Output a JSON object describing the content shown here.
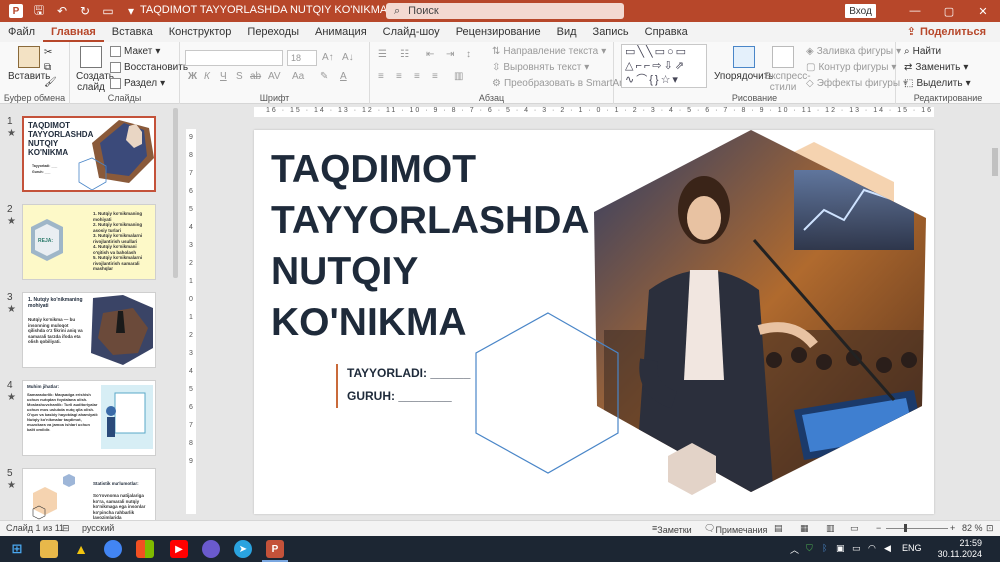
{
  "titlebar": {
    "doc_title": "TAQDIMOT TAYYORLASHDA NUTQIY KO'NIKMA  -  PowerPoint",
    "search_placeholder": "Поиск",
    "login_label": "Вход",
    "minimize": "—",
    "restore": "▢",
    "close": "✕"
  },
  "tabs": [
    "Файл",
    "Главная",
    "Вставка",
    "Конструктор",
    "Переходы",
    "Анимация",
    "Слайд-шоу",
    "Рецензирование",
    "Вид",
    "Запись",
    "Справка"
  ],
  "active_tab": "Главная",
  "share_label": "Поделиться",
  "ribbon": {
    "paste_label": "Вставить",
    "clipboard_group": "Буфер обмена",
    "new_slide_label": "Создать слайд",
    "layout_label": "Макет",
    "reset_label": "Восстановить",
    "section_label": "Раздел",
    "slides_group": "Слайды",
    "font_size": "18",
    "font_group": "Шрифт",
    "text_direction_label": "Направление текста",
    "align_text_label": "Выровнять текст",
    "smartart_label": "Преобразовать в SmartArt",
    "paragraph_group": "Абзац",
    "arrange_label": "Упорядочить",
    "quick_styles_label": "Экспресс-стили",
    "shape_fill_label": "Заливка фигуры",
    "shape_outline_label": "Контур фигуры",
    "shape_effects_label": "Эффекты фигуры",
    "drawing_group": "Рисование",
    "find_label": "Найти",
    "replace_label": "Заменить",
    "select_label": "Выделить",
    "editing_group": "Редактирование"
  },
  "thumbnails": [
    {
      "num": "1",
      "title": "TAQDIMOT TAYYORLASHDA NUTQIY KO'NIKMA",
      "selected": true
    },
    {
      "num": "2",
      "title": "REJA:",
      "lines": [
        "1. Nutqiy ko'nikmaning mohiyati",
        "2. Nutqiy ko'nikmaning asosiy turlari",
        "3. Nutqiy ko'nikmalarni rivojlantirish usullari",
        "4. Nutqiy ko'nikmani o'qitish va baholash",
        "5. Nutqiy ko'nikmalarni rivojlantirish samarali mashqlar"
      ]
    },
    {
      "num": "3",
      "title": "1. Nutqiy ko'nikmaning mohiyati",
      "lines": [
        "Nutqiy ko'nikma — bu insonning muloqot qilishda o'z fikrini aniq va samarali tarzda ifoda eta olish qobiliyati."
      ]
    },
    {
      "num": "4",
      "title": "Muhim jihatlar:",
      "lines": [
        "Samaradorlik: Maqsadga erishish uchun nutqdan foydalana olish.",
        "Moslashuvchanlik: Turli auditoriyalar uchun mos uslubda nutq qila olish.",
        "O'quv va kasbiy hayotdagi ahamiyati: Nutqiy ko'nikmalar taqdimot, muzokara va jamoa ishlari uchun kalit omildir."
      ]
    },
    {
      "num": "5",
      "title": "Statistik ma'lumotlar:",
      "lines": [
        "So'rovnoma natijalariga ko'ra, samarali nutqiy ko'nikmaga ega insonlar ko'pincha rahbarlik lavozimlarida"
      ]
    }
  ],
  "slide": {
    "title": "TAQDIMOT TAYYORLASHDA NUTQIY KO'NIKMA",
    "prepared_by": "TAYYORLADI: ______",
    "group": "GURUH: ________"
  },
  "ruler": {
    "horizontal": "16 · 15 · 14 · 13 · 12 · 11 · 10 · 9 · 8 · 7 · 6 · 5 · 4 · 3 · 2 · 1 · 0 · 1 · 2 · 3 · 4 · 5 · 6 · 7 · 8 · 9 · 10 · 11 · 12 · 13 · 14 · 15 · 16",
    "vertical": [
      "9",
      "8",
      "7",
      "6",
      "5",
      "4",
      "3",
      "2",
      "1",
      "0",
      "1",
      "2",
      "3",
      "4",
      "5",
      "6",
      "7",
      "8",
      "9"
    ]
  },
  "status": {
    "slide_counter": "Слайд 1 из 11",
    "language": "русский",
    "notes_label": "Заметки",
    "comments_label": "Примечания",
    "zoom": "82 %"
  },
  "taskbar": {
    "lang": "ENG",
    "time": "21:59",
    "date": "30.11.2024"
  },
  "colors": {
    "accent": "#b7472a",
    "title_text": "#1e2a3a",
    "hex_orange": "#f5d3b0",
    "hex_blue": "#4a86c8"
  }
}
